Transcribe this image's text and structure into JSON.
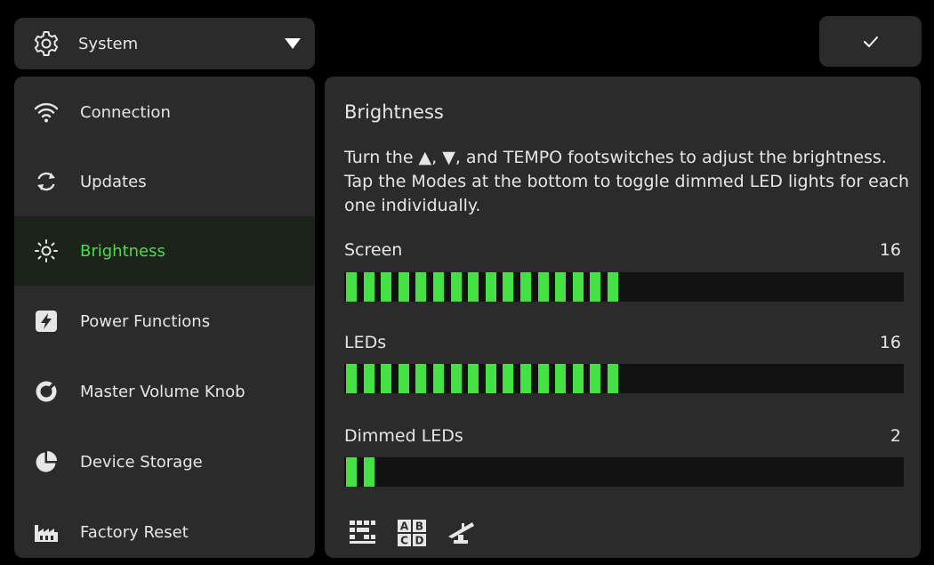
{
  "header": {
    "category": "System",
    "confirm_icon": "checkmark-icon"
  },
  "sidebar": {
    "items": [
      {
        "label": "Connection",
        "icon": "wifi-icon"
      },
      {
        "label": "Updates",
        "icon": "refresh-icon"
      },
      {
        "label": "Brightness",
        "icon": "sun-icon",
        "active": true
      },
      {
        "label": "Power Functions",
        "icon": "lightning-icon"
      },
      {
        "label": "Master Volume Knob",
        "icon": "knob-icon"
      },
      {
        "label": "Device Storage",
        "icon": "pie-icon"
      },
      {
        "label": "Factory Reset",
        "icon": "factory-icon"
      }
    ]
  },
  "main": {
    "title": "Brightness",
    "description": "Turn the ▲, ▼, and TEMPO footswitches to adjust the brightness. Tap the Modes at the bottom to toggle dimmed LED lights for each one individually.",
    "sliders": [
      {
        "label": "Screen",
        "value": "16",
        "level": 16,
        "max": 40
      },
      {
        "label": "LEDs",
        "value": "16",
        "level": 16,
        "max": 40
      },
      {
        "label": "Dimmed LEDs",
        "value": "2",
        "level": 2,
        "max": 40
      }
    ],
    "modes": [
      "grid-mode-icon",
      "abcd-mode-icon",
      "pedal-mode-icon"
    ],
    "mode_letters": [
      "A",
      "B",
      "C",
      "D"
    ]
  },
  "colors": {
    "accent": "#4cdc4c",
    "bar_fill": "#44e044",
    "panel": "#2b2b2b",
    "active_row": "#1c2319"
  }
}
